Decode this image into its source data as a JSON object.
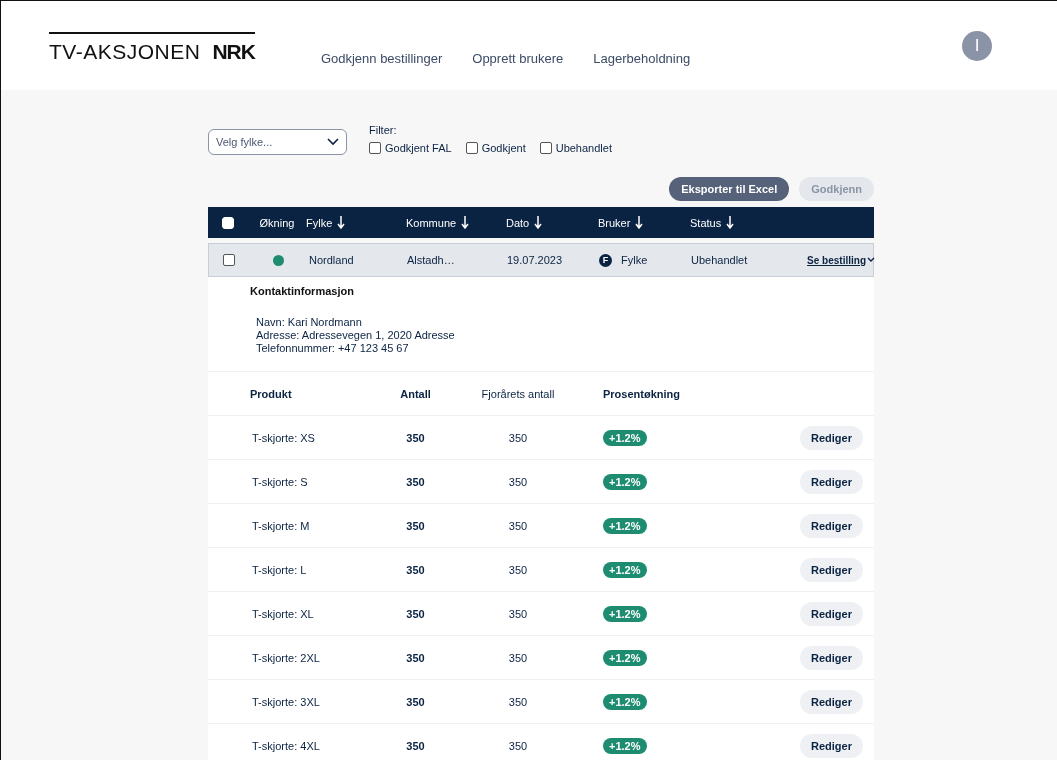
{
  "header": {
    "logo_text": "TV-AKSJONEN",
    "logo_mark": "NRK",
    "nav": [
      {
        "label": "Godkjenn bestillinger"
      },
      {
        "label": "Opprett brukere"
      },
      {
        "label": "Lagerbeholdning"
      }
    ],
    "avatar": "I"
  },
  "toolbar": {
    "county_select": {
      "placeholder": "Velg fylke..."
    },
    "filter_label": "Filter:",
    "filters": [
      {
        "label": "Godkjent FAL",
        "checked": false
      },
      {
        "label": "Godkjent",
        "checked": false
      },
      {
        "label": "Ubehandlet",
        "checked": false
      }
    ]
  },
  "actions": [
    {
      "label": "Eksporter til Excel",
      "disabled": false
    },
    {
      "label": "Godkjenn",
      "disabled": true
    }
  ],
  "table": {
    "select_all": {
      "checked": false
    },
    "columns": [
      {
        "label": "Økning",
        "sortable": false
      },
      {
        "label": "Fylke",
        "sortable": true
      },
      {
        "label": "Kommune",
        "sortable": true
      },
      {
        "label": "Dato",
        "sortable": true
      },
      {
        "label": "Bruker",
        "sortable": true
      },
      {
        "label": "Status",
        "sortable": true
      }
    ],
    "rows": [
      {
        "checked": false,
        "color": "#1e8c70",
        "fylke": "Nordland",
        "kommune": "Alstadh…",
        "dato": "19.07.2023",
        "user_badge": "F",
        "bruker": "Fylke",
        "status": "Ubehandlet",
        "link": "Se bestilling",
        "expanded": true,
        "details": {
          "contact_title": "Kontaktinformasjon",
          "contact_lines": [
            "Navn: Kari Nordmann",
            "Adresse: Adressevegen 1, 2020 Adresse",
            "Telefonnummer: +47 123 45 67"
          ],
          "product_columns": [
            "Produkt",
            "Antall",
            "Fjorårets antall",
            "Prosentøkning"
          ],
          "products": [
            {
              "name": "T-skjorte: XS",
              "antall": "350",
              "last_year": "350",
              "increase": "+1.2%",
              "action": "Rediger"
            },
            {
              "name": "T-skjorte: S",
              "antall": "350",
              "last_year": "350",
              "increase": "+1.2%",
              "action": "Rediger"
            },
            {
              "name": "T-skjorte: M",
              "antall": "350",
              "last_year": "350",
              "increase": "+1.2%",
              "action": "Rediger"
            },
            {
              "name": "T-skjorte: L",
              "antall": "350",
              "last_year": "350",
              "increase": "+1.2%",
              "action": "Rediger"
            },
            {
              "name": "T-skjorte: XL",
              "antall": "350",
              "last_year": "350",
              "increase": "+1.2%",
              "action": "Rediger"
            },
            {
              "name": "T-skjorte: 2XL",
              "antall": "350",
              "last_year": "350",
              "increase": "+1.2%",
              "action": "Rediger"
            },
            {
              "name": "T-skjorte: 3XL",
              "antall": "350",
              "last_year": "350",
              "increase": "+1.2%",
              "action": "Rediger"
            },
            {
              "name": "T-skjorte: 4XL",
              "antall": "350",
              "last_year": "350",
              "increase": "+1.2%",
              "action": "Rediger"
            }
          ]
        }
      }
    ]
  }
}
